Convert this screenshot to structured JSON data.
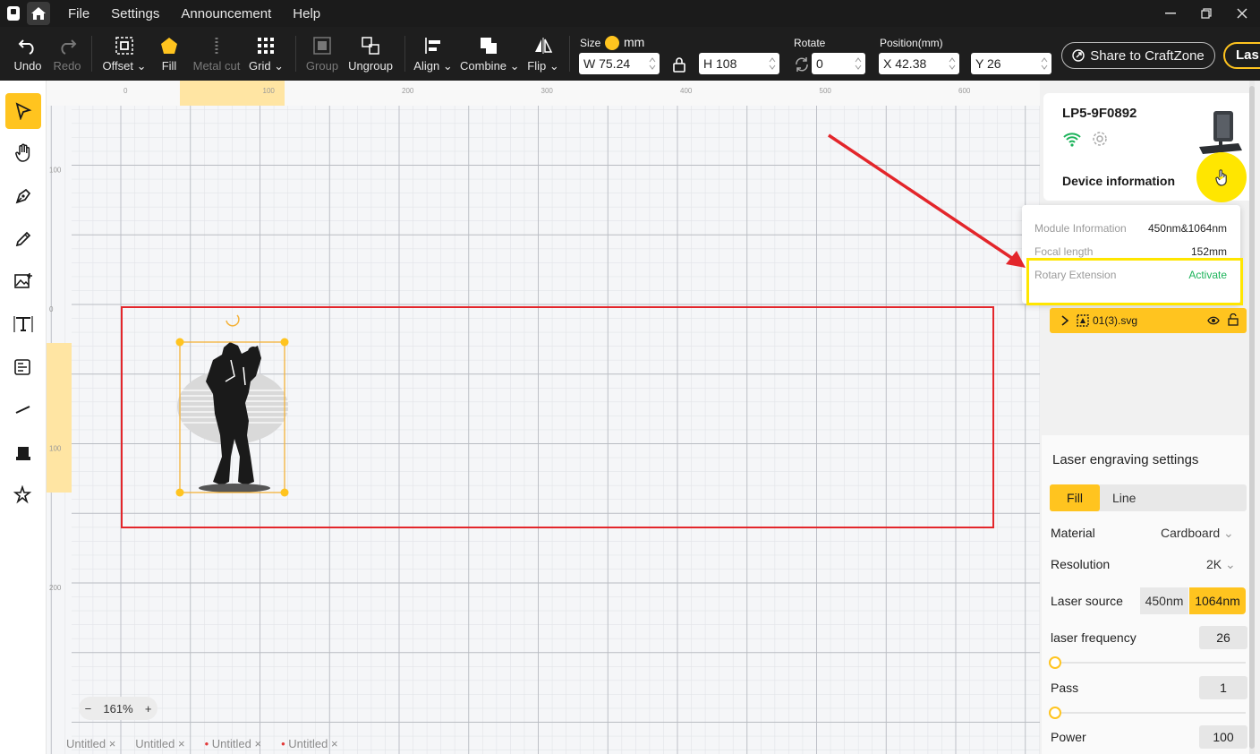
{
  "menu": [
    "File",
    "Settings",
    "Announcement",
    "Help"
  ],
  "toolbar": {
    "undo": "Undo",
    "redo": "Redo",
    "offset": "Offset",
    "fill": "Fill",
    "metal_cut": "Metal cut",
    "grid": "Grid",
    "group": "Group",
    "ungroup": "Ungroup",
    "align": "Align",
    "combine": "Combine",
    "flip": "Flip",
    "size_label": "Size",
    "unit": "mm",
    "width": "W 75.24",
    "height": "H 108",
    "rotate_label": "Rotate",
    "rotate": "0",
    "position_label": "Position(mm)",
    "x": "X 42.38",
    "y": "Y 26",
    "share": "Share to CraftZone",
    "laser": "Las"
  },
  "ruler": {
    "top_ticks": [
      "0",
      "100",
      "200",
      "300",
      "400",
      "500",
      "600"
    ],
    "left_ticks": [
      "100",
      "0",
      "100",
      "200"
    ]
  },
  "canvas": {
    "zoom": "161%"
  },
  "tabs": [
    {
      "label": "Untitled",
      "unsaved": false
    },
    {
      "label": "Untitled",
      "unsaved": false
    },
    {
      "label": "Untitled",
      "unsaved": true
    },
    {
      "label": "Untitled",
      "unsaved": true
    }
  ],
  "device": {
    "name": "LP5-9F0892",
    "info_title": "Device information",
    "module_label": "Module Information",
    "module_value": "450nm&1064nm",
    "focal_label": "Focal length",
    "focal_value": "152mm",
    "rotary_label": "Rotary Extension",
    "rotary_value": "Activate"
  },
  "layer": {
    "name": "01(3).svg"
  },
  "settings": {
    "title": "Laser engraving settings",
    "mode_fill": "Fill",
    "mode_line": "Line",
    "material_label": "Material",
    "material_value": "Cardboard",
    "resolution_label": "Resolution",
    "resolution_value": "2K",
    "source_label": "Laser source",
    "source_450": "450nm",
    "source_1064": "1064nm",
    "frequency_label": "laser frequency",
    "frequency_value": "26",
    "pass_label": "Pass",
    "pass_value": "1",
    "power_label": "Power",
    "power_value": "100"
  },
  "colors": {
    "accent": "#ffc41f",
    "annotation": "#e3262b",
    "highlight": "#ffe600",
    "active_green": "#1cb35a"
  }
}
